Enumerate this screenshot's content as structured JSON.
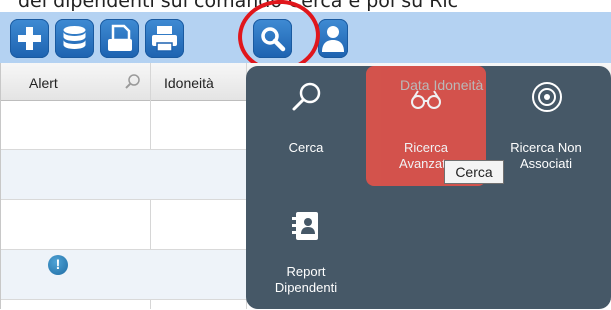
{
  "caption": "dei dipendenti sul comando Cerca e poi su Ric",
  "toolbar": {
    "buttons": [
      {
        "icon": "plus-icon"
      },
      {
        "icon": "database-icon"
      },
      {
        "icon": "document-icon"
      },
      {
        "icon": "printer-icon"
      },
      {
        "icon": "search-icon"
      },
      {
        "icon": "user-icon"
      }
    ]
  },
  "grid": {
    "columns": [
      {
        "label": "Alert"
      },
      {
        "label": "Idoneità"
      },
      {
        "label": "Data Idoneità"
      }
    ],
    "alert_badge": "!"
  },
  "menu": {
    "items": [
      {
        "label_line1": "Cerca",
        "label_line2": "",
        "icon": "magnifier-icon"
      },
      {
        "label_line1": "Ricerca",
        "label_line2": "Avanzata",
        "icon": "glasses-icon"
      },
      {
        "label_line1": "Ricerca Non",
        "label_line2": "Associati",
        "icon": "target-icon"
      },
      {
        "label_line1": "Report",
        "label_line2": "Dipendenti",
        "icon": "contacts-icon"
      }
    ],
    "accent": "#e0524a",
    "background": "#465867"
  },
  "tooltip": "Cerca"
}
